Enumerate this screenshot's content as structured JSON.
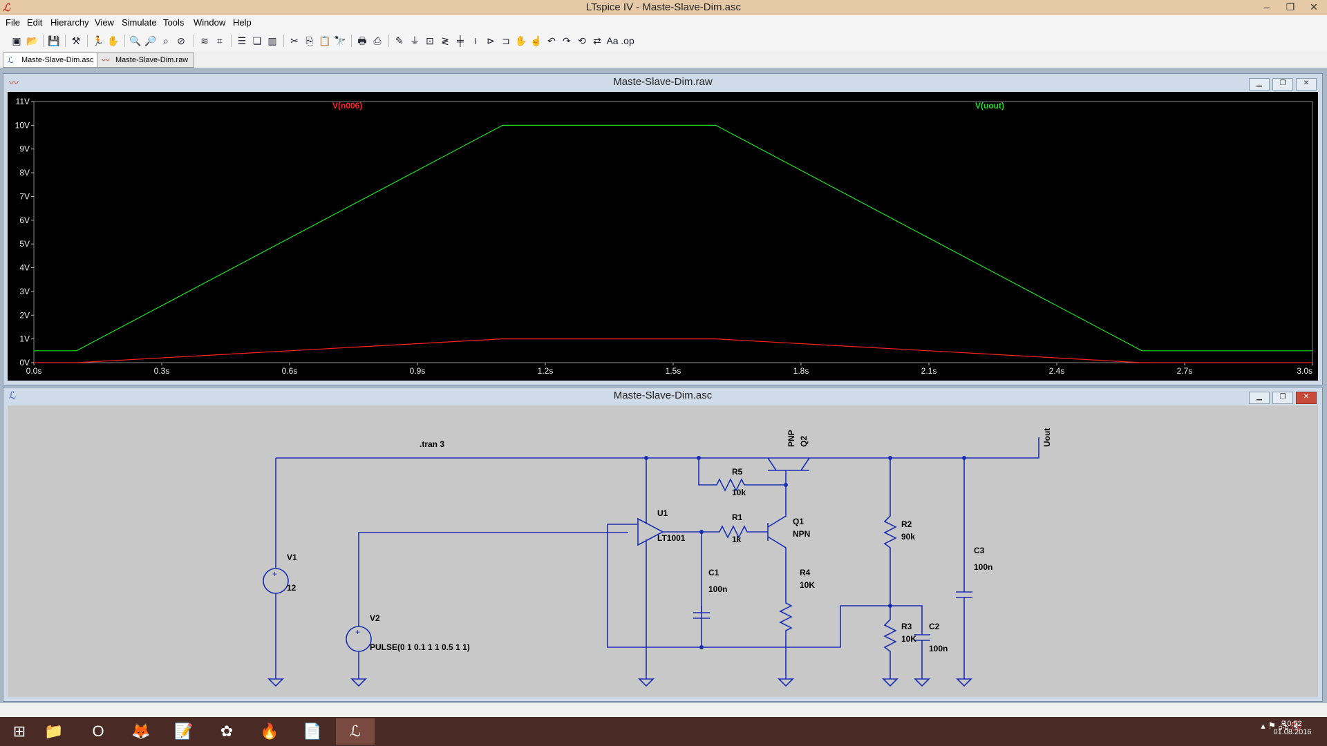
{
  "window": {
    "title": "LTspice IV - Maste-Slave-Dim.asc"
  },
  "menu": [
    "File",
    "Edit",
    "Hierarchy",
    "View",
    "Simulate",
    "Tools",
    "Window",
    "Help"
  ],
  "tabs": [
    {
      "label": "Maste-Slave-Dim.asc",
      "icon": "schematic-icon"
    },
    {
      "label": "Maste-Slave-Dim.raw",
      "icon": "waveform-icon"
    }
  ],
  "waveform_window": {
    "title": "Maste-Slave-Dim.raw"
  },
  "schematic_window": {
    "title": "Maste-Slave-Dim.asc"
  },
  "chart_data": {
    "type": "line",
    "x": [
      0.0,
      0.1,
      1.1,
      1.6,
      2.6,
      3.0
    ],
    "series": [
      {
        "name": "V(n006)",
        "color": "#ff2020",
        "values": [
          0.0,
          0.0,
          1.0,
          1.0,
          0.0,
          0.0
        ]
      },
      {
        "name": "V(uout)",
        "color": "#20e020",
        "values": [
          0.5,
          0.5,
          10.0,
          10.0,
          0.5,
          0.5
        ]
      }
    ],
    "xlim": [
      0.0,
      3.0
    ],
    "ylim": [
      0,
      11
    ],
    "xticks": [
      "0.0s",
      "0.3s",
      "0.6s",
      "0.9s",
      "1.2s",
      "1.5s",
      "1.8s",
      "2.1s",
      "2.4s",
      "2.7s",
      "3.0s"
    ],
    "yticks": [
      "0V",
      "1V",
      "2V",
      "3V",
      "4V",
      "5V",
      "6V",
      "7V",
      "8V",
      "9V",
      "10V",
      "11V"
    ],
    "title": "",
    "xlabel": "",
    "ylabel": ""
  },
  "schematic": {
    "directive": ".tran 3",
    "components": {
      "V1": {
        "name": "V1",
        "value": "12"
      },
      "V2": {
        "name": "V2",
        "value": "PULSE(0 1 0.1 1 1 0.5 1 1)"
      },
      "U1": {
        "name": "U1",
        "value": "LT1001"
      },
      "R1": {
        "name": "R1",
        "value": "1k"
      },
      "R2": {
        "name": "R2",
        "value": "90k"
      },
      "R3": {
        "name": "R3",
        "value": "10K"
      },
      "R4": {
        "name": "R4",
        "value": "10K"
      },
      "R5": {
        "name": "R5",
        "value": "10k"
      },
      "C1": {
        "name": "C1",
        "value": "100n"
      },
      "C2": {
        "name": "C2",
        "value": "100n"
      },
      "C3": {
        "name": "C3",
        "value": "100n"
      },
      "Q1": {
        "name": "Q1",
        "value": "NPN"
      },
      "Q2": {
        "name": "Q2",
        "value": "PNP"
      }
    },
    "net_label": "Uout"
  },
  "taskbar": {
    "apps": [
      "windows-start-icon",
      "file-explorer-icon",
      "opera-icon",
      "firefox-icon",
      "notepad-icon",
      "gimp-icon",
      "torch-icon",
      "pdf-icon",
      "ltspice-icon"
    ],
    "time": "10:52",
    "date": "01.08.2016"
  }
}
